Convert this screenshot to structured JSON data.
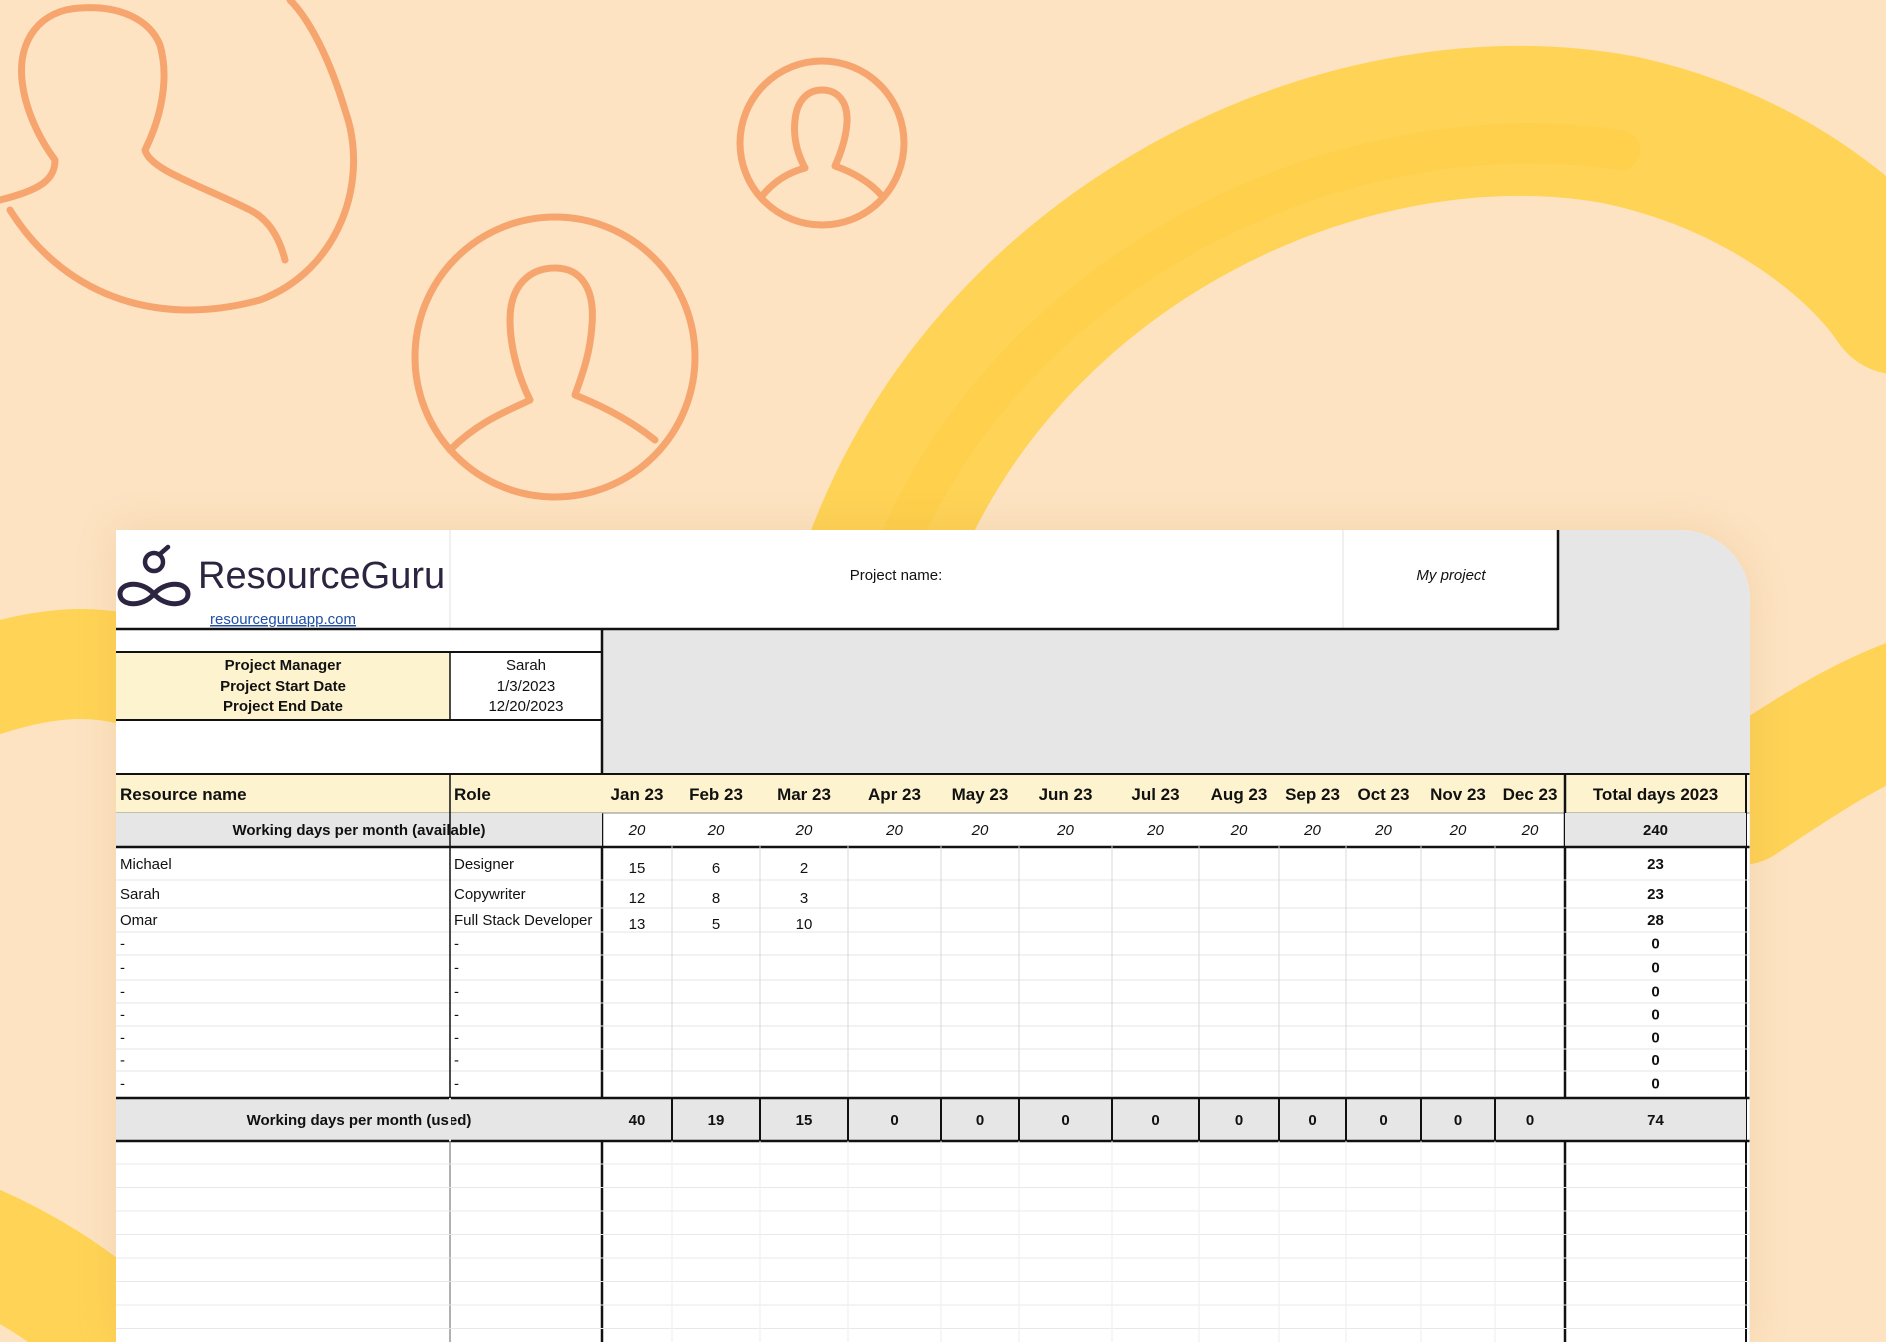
{
  "brand": {
    "name": "ResourceGuru",
    "link": "resourceguruapp.com"
  },
  "project": {
    "name_label": "Project name:",
    "name_value": "My project",
    "info": [
      {
        "label": "Project Manager",
        "value": "Sarah"
      },
      {
        "label": "Project Start Date",
        "value": "1/3/2023"
      },
      {
        "label": "Project End Date",
        "value": "12/20/2023"
      }
    ]
  },
  "table": {
    "col_resource": "Resource name",
    "col_role": "Role",
    "months": [
      "Jan 23",
      "Feb 23",
      "Mar 23",
      "Apr 23",
      "May 23",
      "Jun 23",
      "Jul 23",
      "Aug 23",
      "Sep 23",
      "Oct 23",
      "Nov 23",
      "Dec 23"
    ],
    "col_total": "Total days 2023",
    "available_label": "Working days per month (available)",
    "available_values": [
      "20",
      "20",
      "20",
      "20",
      "20",
      "20",
      "20",
      "20",
      "20",
      "20",
      "20",
      "20"
    ],
    "available_total": "240",
    "rows": [
      {
        "name": "Michael",
        "role": "Designer",
        "values": [
          "15",
          "6",
          "2",
          "",
          "",
          "",
          "",
          "",
          "",
          "",
          "",
          ""
        ],
        "total": "23"
      },
      {
        "name": "Sarah",
        "role": "Copywriter",
        "values": [
          "12",
          "8",
          "3",
          "",
          "",
          "",
          "",
          "",
          "",
          "",
          "",
          ""
        ],
        "total": "23"
      },
      {
        "name": "Omar",
        "role": "Full Stack Developer",
        "values": [
          "13",
          "5",
          "10",
          "",
          "",
          "",
          "",
          "",
          "",
          "",
          "",
          ""
        ],
        "total": "28"
      },
      {
        "name": "-",
        "role": "-",
        "values": [
          "",
          "",
          "",
          "",
          "",
          "",
          "",
          "",
          "",
          "",
          "",
          ""
        ],
        "total": "0"
      },
      {
        "name": "-",
        "role": "-",
        "values": [
          "",
          "",
          "",
          "",
          "",
          "",
          "",
          "",
          "",
          "",
          "",
          ""
        ],
        "total": "0"
      },
      {
        "name": "-",
        "role": "-",
        "values": [
          "",
          "",
          "",
          "",
          "",
          "",
          "",
          "",
          "",
          "",
          "",
          ""
        ],
        "total": "0"
      },
      {
        "name": "-",
        "role": "-",
        "values": [
          "",
          "",
          "",
          "",
          "",
          "",
          "",
          "",
          "",
          "",
          "",
          ""
        ],
        "total": "0"
      },
      {
        "name": "-",
        "role": "-",
        "values": [
          "",
          "",
          "",
          "",
          "",
          "",
          "",
          "",
          "",
          "",
          "",
          ""
        ],
        "total": "0"
      },
      {
        "name": "-",
        "role": "-",
        "values": [
          "",
          "",
          "",
          "",
          "",
          "",
          "",
          "",
          "",
          "",
          "",
          ""
        ],
        "total": "0"
      },
      {
        "name": "-",
        "role": "-",
        "values": [
          "",
          "",
          "",
          "",
          "",
          "",
          "",
          "",
          "",
          "",
          "",
          ""
        ],
        "total": "0"
      }
    ],
    "used_label": "Working days per month (used)",
    "used_values": [
      "40",
      "19",
      "15",
      "0",
      "0",
      "0",
      "0",
      "0",
      "0",
      "0",
      "0",
      "0"
    ],
    "used_total": "74"
  },
  "colors": {
    "background": "#fde3c2",
    "user_icon_stroke": "#f7a56e",
    "brush_stroke": "#ffd24d",
    "header_fill": "#fdf4cf",
    "gray_fill": "#e6e6e6"
  },
  "icons": [
    "user-avatar-icon",
    "resourceguru-logo-icon"
  ]
}
